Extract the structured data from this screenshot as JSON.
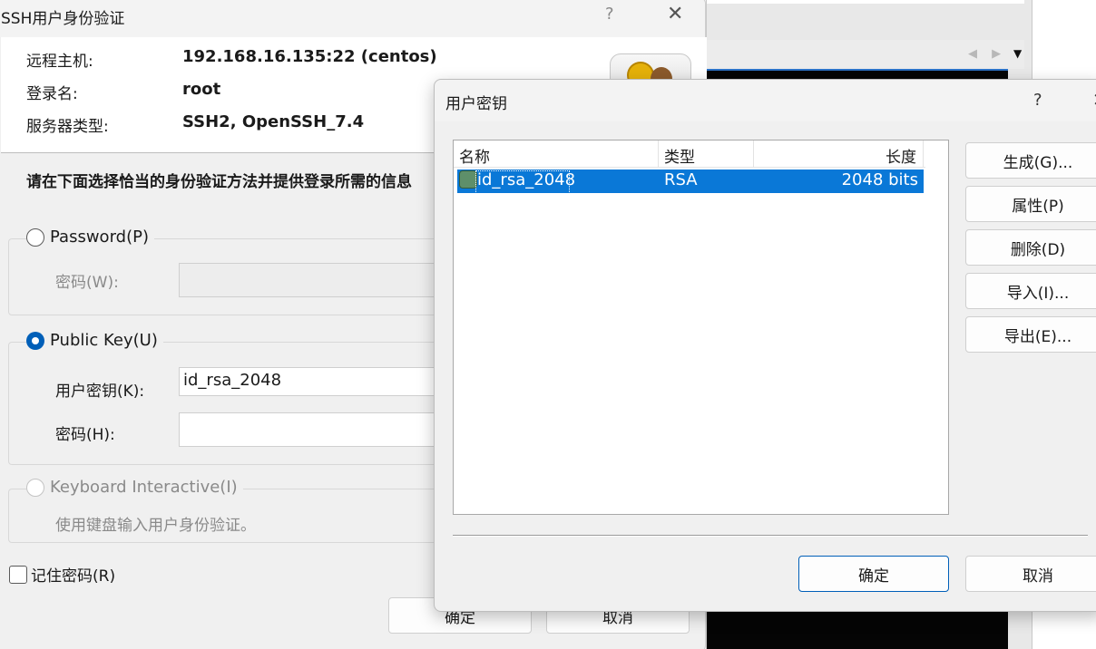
{
  "ssh_dialog": {
    "title": "SSH用户身份验证",
    "help": "?",
    "close": "✕",
    "info": {
      "host_label": "远程主机:",
      "host_value": "192.168.16.135:22 (centos)",
      "login_label": "登录名:",
      "login_value": "root",
      "server_label": "服务器类型:",
      "server_value": "SSH2, OpenSSH_7.4"
    },
    "instruction": "请在下面选择恰当的身份验证方法并提供登录所需的信息",
    "password_method": {
      "radio_label": "Password(P)",
      "selected": false,
      "field_label": "密码(W):",
      "value": ""
    },
    "publickey_method": {
      "radio_label": "Public Key(U)",
      "selected": true,
      "key_label": "用户密钥(K):",
      "key_value": "id_rsa_2048",
      "pass_label": "密码(H):",
      "pass_value": ""
    },
    "keyboard_method": {
      "radio_label": "Keyboard Interactive(I)",
      "selected": false,
      "description": "使用键盘输入用户身份验证。"
    },
    "remember_password": {
      "label": "记住密码(R)",
      "checked": false
    },
    "ok_button": "确定",
    "cancel_button": "取消"
  },
  "keys_dialog": {
    "title": "用户密钥",
    "help": "?",
    "close": "✕",
    "columns": [
      "名称",
      "类型",
      "长度"
    ],
    "rows": [
      {
        "name": "id_rsa_2048",
        "type": "RSA",
        "length": "2048 bits",
        "selected": true
      }
    ],
    "side_buttons": {
      "generate": "生成(G)...",
      "properties": "属性(P)",
      "delete": "删除(D)",
      "import": "导入(I)...",
      "export": "导出(E)..."
    },
    "ok_button": "确定",
    "cancel_button": "取消"
  },
  "background_window": {
    "tab_arrows": "◀ ▶",
    "dropdown": "▼"
  },
  "colors": {
    "accent": "#005fb8",
    "selection": "#0a78d7",
    "terminal": "#050505"
  }
}
